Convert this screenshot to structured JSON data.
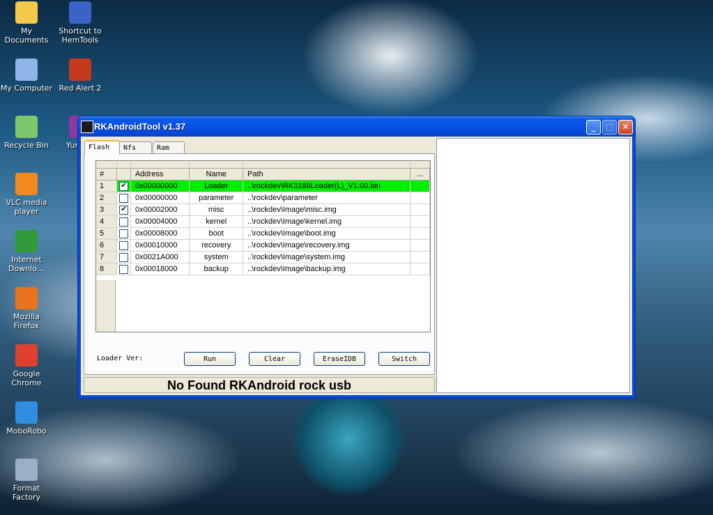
{
  "desktop": {
    "icons": [
      {
        "label": "My Documents",
        "icon": "folder-icon",
        "color": "#f4c94a"
      },
      {
        "label": "Shortcut to HemTools",
        "icon": "tools-icon",
        "color": "#3a63c8"
      },
      {
        "label": "My Computer",
        "icon": "computer-icon",
        "color": "#8fb4e8"
      },
      {
        "label": "Red Alert 2",
        "icon": "game-icon",
        "color": "#c43a1e"
      },
      {
        "label": "Recycle Bin",
        "icon": "recycle-bin-icon",
        "color": "#7ec86b"
      },
      {
        "label": "Yuri's R",
        "icon": "game-icon",
        "color": "#8a3a9e"
      },
      {
        "label": "VLC media player",
        "icon": "vlc-icon",
        "color": "#f08a1e"
      },
      {
        "label": "Internet Downlo…",
        "icon": "download-icon",
        "color": "#2f9a3a"
      },
      {
        "label": "Mozilla Firefox",
        "icon": "firefox-icon",
        "color": "#e8741e"
      },
      {
        "label": "Google Chrome",
        "icon": "chrome-icon",
        "color": "#e0402f"
      },
      {
        "label": "MoboRobo",
        "icon": "mobo-icon",
        "color": "#2f8ee0"
      },
      {
        "label": "Format Factory",
        "icon": "factory-icon",
        "color": "#9ab0c4"
      }
    ]
  },
  "window": {
    "title": "RKAndroidTool v1.37",
    "controls": {
      "minimize": "_",
      "maximize": "□",
      "close": "✕"
    },
    "tabs": [
      "Flash",
      "Nfs",
      "Ram"
    ],
    "table": {
      "headers": [
        "#",
        "",
        "Address",
        "Name",
        "Path",
        "..."
      ],
      "rows": [
        {
          "num": "1",
          "checked": true,
          "address": "0x00000000",
          "name": "Loader",
          "path": "..\\rockdev\\RK3188Loader(L)_V1.00.bin",
          "selected": true
        },
        {
          "num": "2",
          "checked": false,
          "address": "0x00000000",
          "name": "parameter",
          "path": "..\\rockdev\\parameter",
          "selected": false
        },
        {
          "num": "3",
          "checked": true,
          "address": "0x00002000",
          "name": "misc",
          "path": "..\\rockdev\\Image\\misc.img",
          "selected": false
        },
        {
          "num": "4",
          "checked": false,
          "address": "0x00004000",
          "name": "kernel",
          "path": "..\\rockdev\\Image\\kernel.img",
          "selected": false
        },
        {
          "num": "5",
          "checked": false,
          "address": "0x00008000",
          "name": "boot",
          "path": "..\\rockdev\\Image\\boot.img",
          "selected": false
        },
        {
          "num": "6",
          "checked": false,
          "address": "0x00010000",
          "name": "recovery",
          "path": "..\\rockdev\\Image\\recovery.img",
          "selected": false
        },
        {
          "num": "7",
          "checked": false,
          "address": "0x0021A000",
          "name": "system",
          "path": "..\\rockdev\\Image\\system.img",
          "selected": false
        },
        {
          "num": "8",
          "checked": false,
          "address": "0x00018000",
          "name": "backup",
          "path": "..\\rockdev\\Image\\backup.img",
          "selected": false
        }
      ]
    },
    "loader_label": "Loader Ver:",
    "buttons": {
      "run": "Run",
      "clear": "Clear",
      "erase": "EraseIDB",
      "switch": "Switch"
    },
    "status": "No Found RKAndroid rock usb"
  }
}
